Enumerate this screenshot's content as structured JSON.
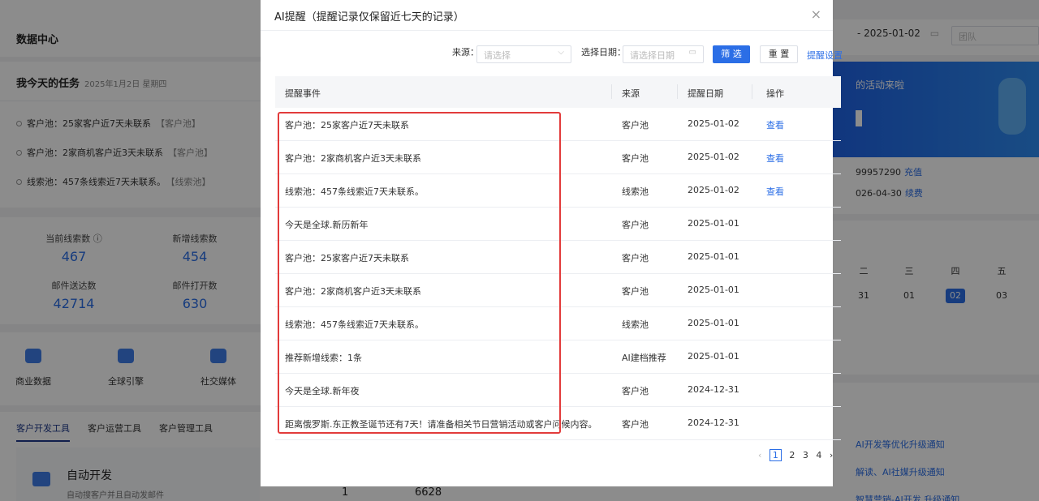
{
  "background": {
    "header_title": "数据中心",
    "tasks": {
      "title": "我今天的任务",
      "date": "2025年1月2日 星期四",
      "items": [
        {
          "text": "客户池：25家客户近7天未联系",
          "tag": "【客户池】"
        },
        {
          "text": "客户池：2家商机客户近3天未联系",
          "tag": "【客户池】"
        },
        {
          "text": "线索池：457条线索近7天未联系。",
          "tag": "【线索池】"
        }
      ]
    },
    "stats": [
      {
        "label": "当前线索数 ⓘ",
        "value": "467"
      },
      {
        "label": "新增线索数",
        "value": "454"
      },
      {
        "label": "邮件送达数",
        "value": "42714"
      },
      {
        "label": "邮件打开数",
        "value": "630"
      }
    ],
    "quick_icons": [
      "商业数据",
      "全球引擎",
      "社交媒体"
    ],
    "tool_tabs": [
      "客户开发工具",
      "客户运营工具",
      "客户管理工具"
    ],
    "tool_card": {
      "title": "自动开发",
      "desc": "自动搜客户并且自动发邮件"
    },
    "under_modal": {
      "n1": "1",
      "n2": "6628"
    },
    "date_range_end": "- 2025-01-02",
    "team_placeholder": "团队",
    "banner_text": "的活动来啦",
    "account": [
      {
        "text": "99957290",
        "link": "充值"
      },
      {
        "text": "026-04-30",
        "link": "续费"
      }
    ],
    "calendar": {
      "weekdays": [
        "二",
        "三",
        "四",
        "五"
      ],
      "days": [
        "31",
        "01",
        "02",
        "03"
      ]
    },
    "news": [
      "AI开发等优化升级通知",
      "解读、AI社媒升级通知",
      "智慧营销-AI开发 升级通知"
    ]
  },
  "modal": {
    "title": "AI提醒（提醒记录仅保留近七天的记录）",
    "close": "×",
    "filters": {
      "source_label": "来源：",
      "source_placeholder": "请选择",
      "date_label": "选择日期：",
      "date_placeholder": "请选择日期",
      "filter_btn": "筛 选",
      "reset_btn": "重 置",
      "settings_link": "提醒设置"
    },
    "columns": [
      "提醒事件",
      "来源",
      "提醒日期",
      "操作"
    ],
    "rows": [
      {
        "event": "客户池：25家客户近7天未联系",
        "source": "客户池",
        "date": "2025-01-02",
        "action": "查看"
      },
      {
        "event": "客户池：2家商机客户近3天未联系",
        "source": "客户池",
        "date": "2025-01-02",
        "action": "查看"
      },
      {
        "event": "线索池：457条线索近7天未联系。",
        "source": "线索池",
        "date": "2025-01-02",
        "action": "查看"
      },
      {
        "event": "今天是全球.新历新年",
        "source": "客户池",
        "date": "2025-01-01",
        "action": ""
      },
      {
        "event": "客户池：25家客户近7天未联系",
        "source": "客户池",
        "date": "2025-01-01",
        "action": ""
      },
      {
        "event": "客户池：2家商机客户近3天未联系",
        "source": "客户池",
        "date": "2025-01-01",
        "action": ""
      },
      {
        "event": "线索池：457条线索近7天未联系。",
        "source": "线索池",
        "date": "2025-01-01",
        "action": ""
      },
      {
        "event": "推荐新增线索：1条",
        "source": "AI建档推荐",
        "date": "2025-01-01",
        "action": ""
      },
      {
        "event": "今天是全球.新年夜",
        "source": "客户池",
        "date": "2024-12-31",
        "action": ""
      },
      {
        "event": "距离俄罗斯.东正教圣诞节还有7天！请准备相关节日营销活动或客户问候内容。",
        "source": "客户池",
        "date": "2024-12-31",
        "action": ""
      }
    ],
    "pagination": {
      "prev": "‹",
      "pages": [
        "1",
        "2",
        "3",
        "4"
      ],
      "next": "›",
      "current": "1"
    }
  }
}
